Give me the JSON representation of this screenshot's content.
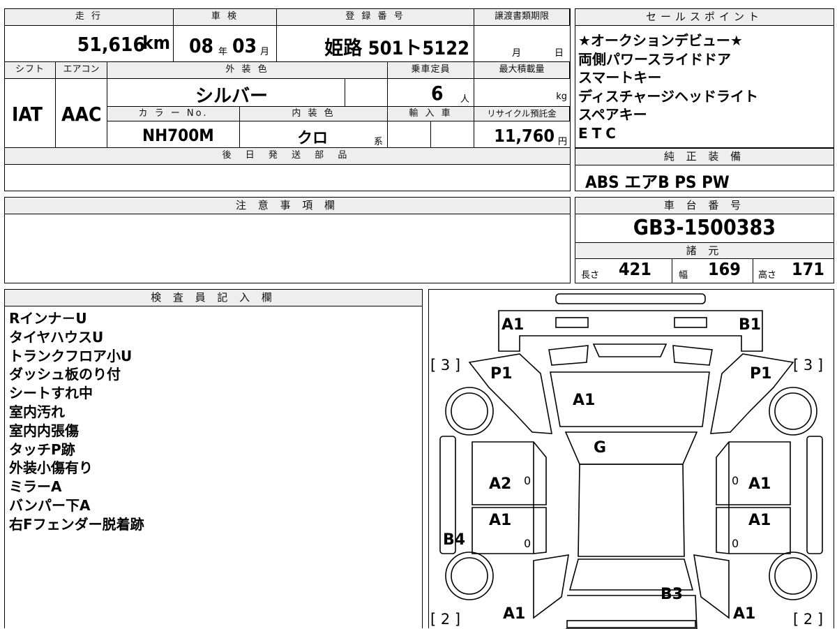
{
  "top": {
    "mileage_label": "走 行",
    "mileage_value": "51,616",
    "mileage_unit": "km",
    "shaken_label": "車 検",
    "shaken_year": "08",
    "shaken_year_unit": "年",
    "shaken_month": "03",
    "shaken_month_unit": "月",
    "reg_label": "登 録 番 号",
    "reg_value": "姫路 501ト5122",
    "transfer_label": "譲渡書類期限",
    "transfer_month": "月",
    "transfer_day": "日",
    "shift_label": "シフト",
    "shift_value": "IAT",
    "ac_label": "エアコン",
    "ac_value": "AAC",
    "exterior_label": "外 装 色",
    "exterior_value": "シルバー",
    "capacity_label": "乗車定員",
    "capacity_value": "6",
    "capacity_unit": "人",
    "maxload_label": "最大積載量",
    "maxload_unit": "kg",
    "color_no_label": "カ ラ ー No.",
    "color_no_value": "NH700M",
    "interior_label": "内 装 色",
    "interior_value": "クロ",
    "interior_unit": "系",
    "import_label": "輸 入 車",
    "recycle_label": "リサイクル預託金",
    "recycle_value": "11,760",
    "recycle_unit": "円",
    "later_parts_label": "後 日 発 送 部 品"
  },
  "sales": {
    "header": "セールスポイント",
    "lines": [
      "★オークションデビュー★",
      "両側パワースライドドア",
      "スマートキー",
      "ディスチャージヘッドライト",
      "スペアキー",
      "ETC"
    ]
  },
  "equipment": {
    "header": "純 正 装 備",
    "value": "ABS エアB PS PW"
  },
  "notes": {
    "header": "注 意 事 項 欄"
  },
  "chassis": {
    "header": "車 台 番 号",
    "value": "GB3-1500383",
    "spec_header": "諸 元",
    "length_label": "長さ",
    "length_value": "421",
    "width_label": "幅",
    "width_value": "169",
    "height_label": "高さ",
    "height_value": "171"
  },
  "inspector": {
    "header": "検 査 員 記 入 欄",
    "lines": [
      "Rインナ－U",
      "タイヤハウスU",
      "トランクフロア小U",
      "ダッシュ板のり付",
      "シートすれ中",
      "室内汚れ",
      "室内内張傷",
      "タッチP跡",
      "外装小傷有り",
      "ミラーA",
      "バンパー下A",
      "右Fフェンダー脱着跡"
    ]
  },
  "diagram": {
    "labels": [
      "A1",
      "B1",
      "P1",
      "P1",
      "A1",
      "G",
      "A2",
      "A1",
      "A1",
      "A1",
      "B4",
      "B3",
      "A1",
      "A1"
    ],
    "tire_marks": [
      "[ 3 ]",
      "[ 3 ]",
      "[ 2 ]",
      "[ 2 ]"
    ],
    "zero_marks": [
      "0",
      "0",
      "0",
      "0"
    ]
  }
}
